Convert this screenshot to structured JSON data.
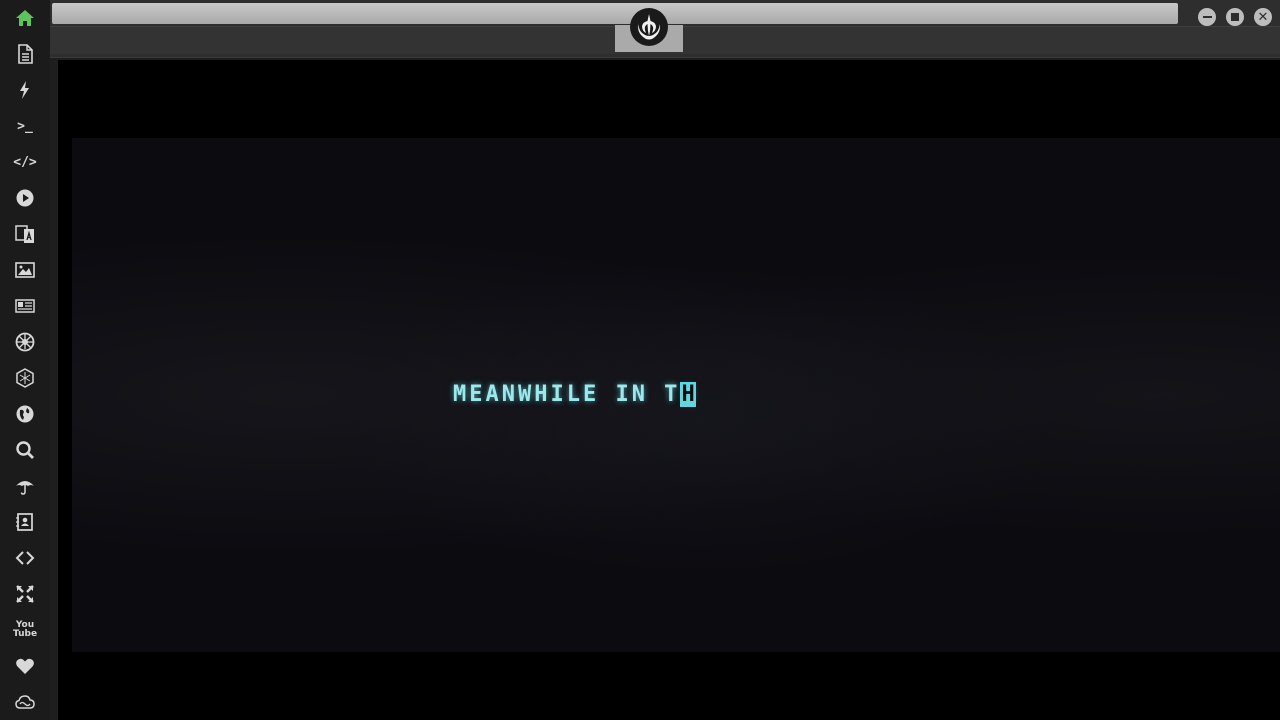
{
  "sidebar": {
    "items": [
      {
        "name": "home",
        "icon": "home-icon",
        "active": true
      },
      {
        "name": "document",
        "icon": "document-icon"
      },
      {
        "name": "bolt",
        "icon": "bolt-icon"
      },
      {
        "name": "terminal",
        "icon": "terminal-icon",
        "text": ">_"
      },
      {
        "name": "code",
        "icon": "code-icon",
        "text": "</>"
      },
      {
        "name": "play",
        "icon": "play-icon"
      },
      {
        "name": "translate",
        "icon": "translate-icon"
      },
      {
        "name": "image",
        "icon": "image-icon"
      },
      {
        "name": "news",
        "icon": "newspaper-icon"
      },
      {
        "name": "empire",
        "icon": "galactic-empire-icon"
      },
      {
        "name": "hexagon",
        "icon": "hexagon-icon"
      },
      {
        "name": "globe",
        "icon": "globe-icon"
      },
      {
        "name": "search",
        "icon": "search-icon"
      },
      {
        "name": "umbrella",
        "icon": "umbrella-icon"
      },
      {
        "name": "contacts",
        "icon": "contact-book-icon"
      },
      {
        "name": "embed",
        "icon": "embed-icon"
      },
      {
        "name": "fullscreen",
        "icon": "expand-icon"
      },
      {
        "name": "youtube",
        "icon": "youtube-icon",
        "text": "You\nTube"
      },
      {
        "name": "favorites",
        "icon": "heart-icon"
      },
      {
        "name": "cloud",
        "icon": "cloud-icon"
      }
    ],
    "active_color": "#5dc35b",
    "icon_color": "#d8d8d8"
  },
  "topbar": {
    "tab_icon": "rebel-alliance-icon",
    "window_controls": [
      "minimize-icon",
      "maximize-icon",
      "close-icon"
    ]
  },
  "content": {
    "crawl_text": "MEANWHILE IN T",
    "cursor_char": "H",
    "text_color": "#9fe8ea"
  }
}
